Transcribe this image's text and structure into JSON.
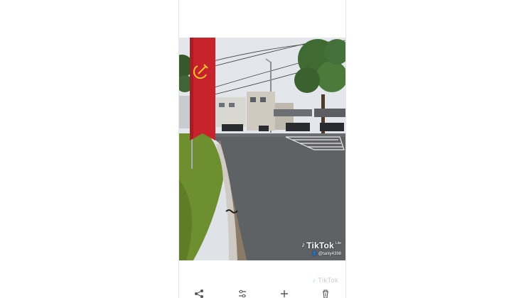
{
  "viewer": {
    "top_title": "• • •"
  },
  "photo": {
    "watermark": {
      "brand": "TikTok",
      "edition": "Lite",
      "username": "@tanly4398"
    },
    "ghost_watermark": "TikTok"
  },
  "toolbar": {
    "items": [
      {
        "icon": "share-icon",
        "glyph": "⤴"
      },
      {
        "icon": "adjust-icon",
        "glyph": "☰"
      },
      {
        "icon": "add-icon",
        "glyph": "+"
      },
      {
        "icon": "delete-icon",
        "glyph": "🗑"
      }
    ]
  },
  "colors": {
    "banner": "#c8232c",
    "emblem": "#f2c230",
    "sky": "#e2e5ea",
    "road": "#5f6264",
    "grass": "#6e8f2f",
    "tree": "#3f6a32"
  }
}
